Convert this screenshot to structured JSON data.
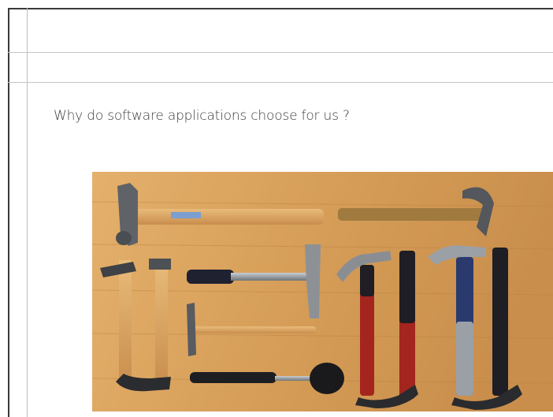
{
  "slide": {
    "question": "Why do software applications choose for us ?"
  },
  "photo": {
    "subject": "hammers-arranged-on-wood",
    "colors": {
      "wood": "#d9a45f",
      "wood_dark": "#b97d3c",
      "handle_light": "#d8a15e",
      "grip_black": "#1e1e24",
      "grip_blue": "#2b3a6e",
      "grip_red": "#a3251e",
      "steel": "#9ea3a8"
    }
  }
}
